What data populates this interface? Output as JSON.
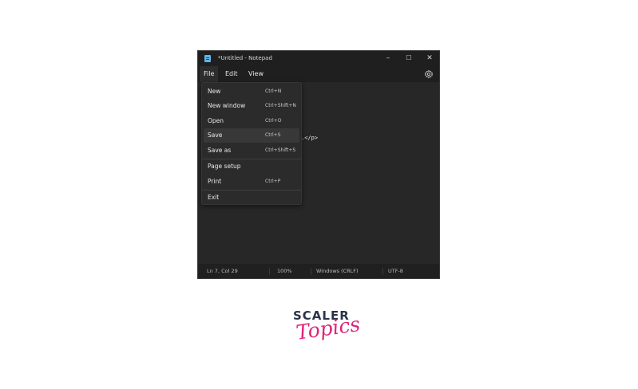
{
  "window": {
    "title": "*Untitled - Notepad",
    "controls": {
      "minimize": "–",
      "maximize": "☐",
      "close": "✕"
    }
  },
  "menubar": {
    "items": [
      "File",
      "Edit",
      "View"
    ],
    "active": "File"
  },
  "file_menu": {
    "items": [
      {
        "label": "New",
        "shortcut": "Ctrl+N"
      },
      {
        "label": "New window",
        "shortcut": "Ctrl+Shift+N"
      },
      {
        "label": "Open",
        "shortcut": "Ctrl+O"
      },
      {
        "label": "Save",
        "shortcut": "Ctrl+S"
      },
      {
        "label": "Save as",
        "shortcut": "Ctrl+Shift+S"
      },
      {
        "label": "Page setup",
        "shortcut": ""
      },
      {
        "label": "Print",
        "shortcut": "Ctrl+P"
      },
      {
        "label": "Exit",
        "shortcut": ""
      }
    ],
    "highlighted": "Save"
  },
  "editor": {
    "visible_text": ".</p>"
  },
  "statusbar": {
    "position": "Ln 7, Col 29",
    "zoom": "100%",
    "line_ending": "Windows (CRLF)",
    "encoding": "UTF-8"
  },
  "branding": {
    "line1": "SCALER",
    "line2": "Topics"
  },
  "colors": {
    "window_bg": "#272727",
    "titlebar_bg": "#1f1f1f",
    "menu_bg": "#2b2b2b",
    "highlight_bg": "#383838",
    "logo_dark": "#2a3349",
    "logo_pink": "#e0237a"
  },
  "icons": [
    "notepad-app-icon",
    "settings-gear-icon"
  ]
}
